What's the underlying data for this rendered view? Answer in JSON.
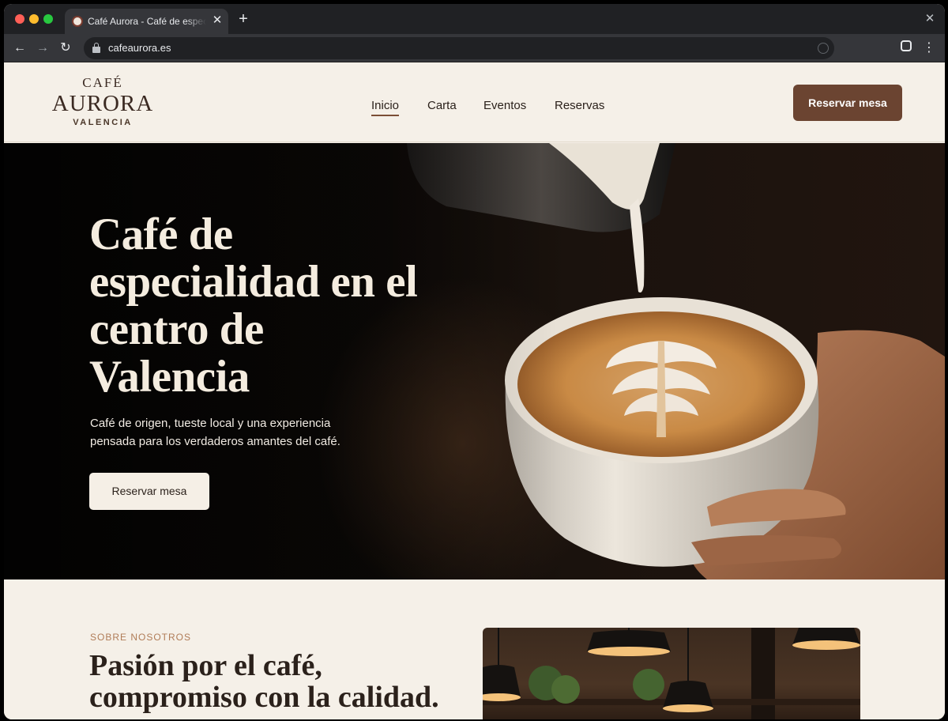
{
  "browser": {
    "tab_title": "Café Aurora - Café de especialidad",
    "tab_close": "✕",
    "new_tab": "+",
    "window_close": "✕",
    "back": "←",
    "forward": "→",
    "reload": "↻",
    "url": "cafeaurora.es",
    "menu": "⋮"
  },
  "header": {
    "logo_top": "CAFÉ",
    "logo_main": "AURORA",
    "logo_sub": "VALENCIA",
    "nav": [
      "Inicio",
      "Carta",
      "Eventos",
      "Reservas"
    ],
    "active_nav": "Inicio",
    "cta": "Reservar mesa"
  },
  "hero": {
    "title": "Café de especialidad en el centro de Valencia",
    "subtitle": "Café de origen, tueste local y una experiencia pensada para los verdaderos amantes del café.",
    "cta": "Reservar mesa"
  },
  "about": {
    "eyebrow": "SOBRE NOSOTROS",
    "title": "Pasión por el café, compromiso con la calidad."
  },
  "colors": {
    "brand_brown": "#6b4431",
    "cream": "#f5f0e8",
    "eyebrow": "#b07c57"
  }
}
